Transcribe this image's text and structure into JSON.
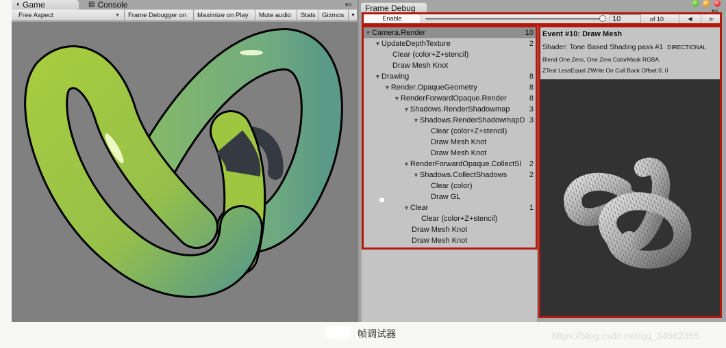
{
  "game_window": {
    "tabs": [
      {
        "label": "Game",
        "icon": "pacman-game-icon",
        "active": true
      },
      {
        "label": "Console",
        "icon": "console-doc-icon",
        "active": false
      }
    ],
    "toolbar": {
      "aspect_label": "Free Aspect",
      "frame_debugger_label": "Frame Debugger on",
      "maximize_label": "Maximize on Play",
      "mute_label": "Mute audio",
      "stats_label": "Stats",
      "gizmos_label": "Gizmos"
    },
    "viewport_bg": "#808080",
    "knot_color": "#9fc63c"
  },
  "frame_debugger": {
    "tab_label": "Frame Debug",
    "window_controls": [
      "#5cc634",
      "#f4a21a",
      "#e8323a"
    ],
    "highlight_color": "#b3180c",
    "toolbar": {
      "enable_label": "Enable",
      "slider_fraction": 1.0,
      "event_value": "10",
      "of_label": "of 10",
      "prev_icon": "◀",
      "next_icon": "▶"
    },
    "tree": [
      {
        "label": "Camera.Render",
        "count": "10",
        "depth": 0,
        "expanded": true,
        "selected": true
      },
      {
        "label": "UpdateDepthTexture",
        "count": "2",
        "depth": 1,
        "expanded": true
      },
      {
        "label": "Clear (color+Z+stencil)",
        "count": "",
        "depth": 2
      },
      {
        "label": "Draw Mesh Knot",
        "count": "",
        "depth": 2
      },
      {
        "label": "Drawing",
        "count": "8",
        "depth": 1,
        "expanded": true
      },
      {
        "label": "Render.OpaqueGeometry",
        "count": "8",
        "depth": 2,
        "expanded": true
      },
      {
        "label": "RenderForwardOpaque.Render",
        "count": "8",
        "depth": 3,
        "expanded": true
      },
      {
        "label": "Shadows.RenderShadowmap",
        "count": "3",
        "depth": 4,
        "expanded": true
      },
      {
        "label": "Shadows.RenderShadowmapD",
        "count": "3",
        "depth": 5,
        "expanded": true
      },
      {
        "label": "Clear (color+Z+stencil)",
        "count": "",
        "depth": 6
      },
      {
        "label": "Draw Mesh Knot",
        "count": "",
        "depth": 6
      },
      {
        "label": "Draw Mesh Knot",
        "count": "",
        "depth": 6
      },
      {
        "label": "RenderForwardOpaque.CollectSl",
        "count": "2",
        "depth": 4,
        "expanded": true
      },
      {
        "label": "Shadows.CollectShadows",
        "count": "2",
        "depth": 5,
        "expanded": true
      },
      {
        "label": "Clear (color)",
        "count": "",
        "depth": 6
      },
      {
        "label": "Draw GL",
        "count": "",
        "depth": 6
      },
      {
        "label": "Clear",
        "count": "1",
        "depth": 4,
        "expanded": true
      },
      {
        "label": "Clear (color+Z+stencil)",
        "count": "",
        "depth": 5
      },
      {
        "label": "Draw Mesh Knot",
        "count": "",
        "depth": 4
      },
      {
        "label": "Draw Mesh Knot",
        "count": "",
        "depth": 4
      }
    ],
    "details": {
      "title": "Event #10: Draw Mesh",
      "shader": "Shader: Tone Based Shading pass #1",
      "shader_keyword": "DIRECTIONAL",
      "blend": "Blend One Zero, One Zero ColorMask RGBA",
      "ztest": "ZTest LessEqual ZWrite On Cull Back Offset 0, 0"
    }
  },
  "caption": "帧调试器",
  "watermark": "https://blog.csdn.net/qq_34562355"
}
